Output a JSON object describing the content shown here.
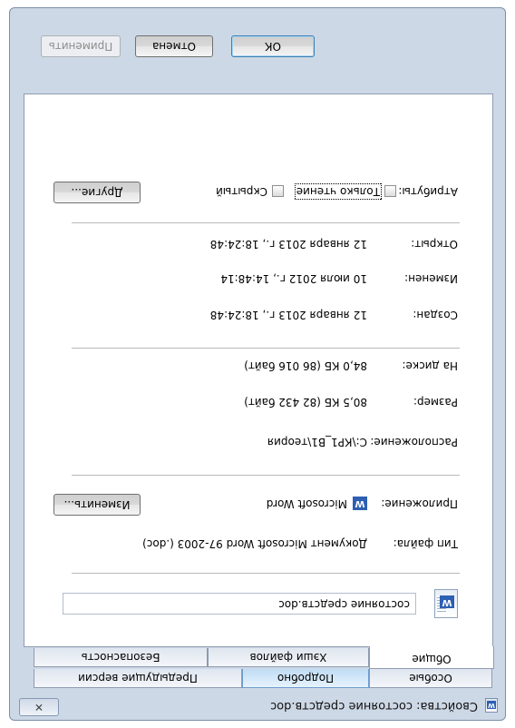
{
  "window": {
    "title": "Свойства: состояние средств.doc",
    "close_glyph": "✕"
  },
  "tabs": {
    "row1": [
      "Общие",
      "Хэши файлов",
      "Безопасность"
    ],
    "row2": [
      "Особые",
      "Подробно",
      "Предыдущие версии"
    ]
  },
  "file": {
    "name": "состояние средств.doc"
  },
  "props": {
    "type_label": "Тип файла:",
    "type_value": "Документ Microsoft Word 97-2003 (.doc)",
    "app_label": "Приложение:",
    "app_value": "Microsoft Word",
    "app_button": "Изменить...",
    "location_label": "Расположение:",
    "location_value": "C:\\КР1_В1\\теория",
    "size_label": "Размер:",
    "size_value": "80,5 КБ (82 432 байт)",
    "disk_label": "На диске:",
    "disk_value": "84,0 КБ (86 016 байт)",
    "created_label": "Создан:",
    "created_value": "12 января 2013 г., 18:24:48",
    "modified_label": "Изменен:",
    "modified_value": "10 июля 2012 г., 14:48:14",
    "opened_label": "Открыт:",
    "opened_value": "12 января 2013 г., 18:24:48",
    "attr_label": "Атрибуты:",
    "readonly_label": "Только чтение",
    "hidden_label": "Скрытый",
    "other_button": "Другие..."
  },
  "buttons": {
    "ok": "ОК",
    "cancel": "Отмена",
    "apply": "Применить"
  },
  "colors": {
    "window_frame": "#cdd8e6",
    "panel": "#ffffff",
    "hover_tab": "#bfdcf4",
    "accent_border": "#3c7fb1"
  }
}
